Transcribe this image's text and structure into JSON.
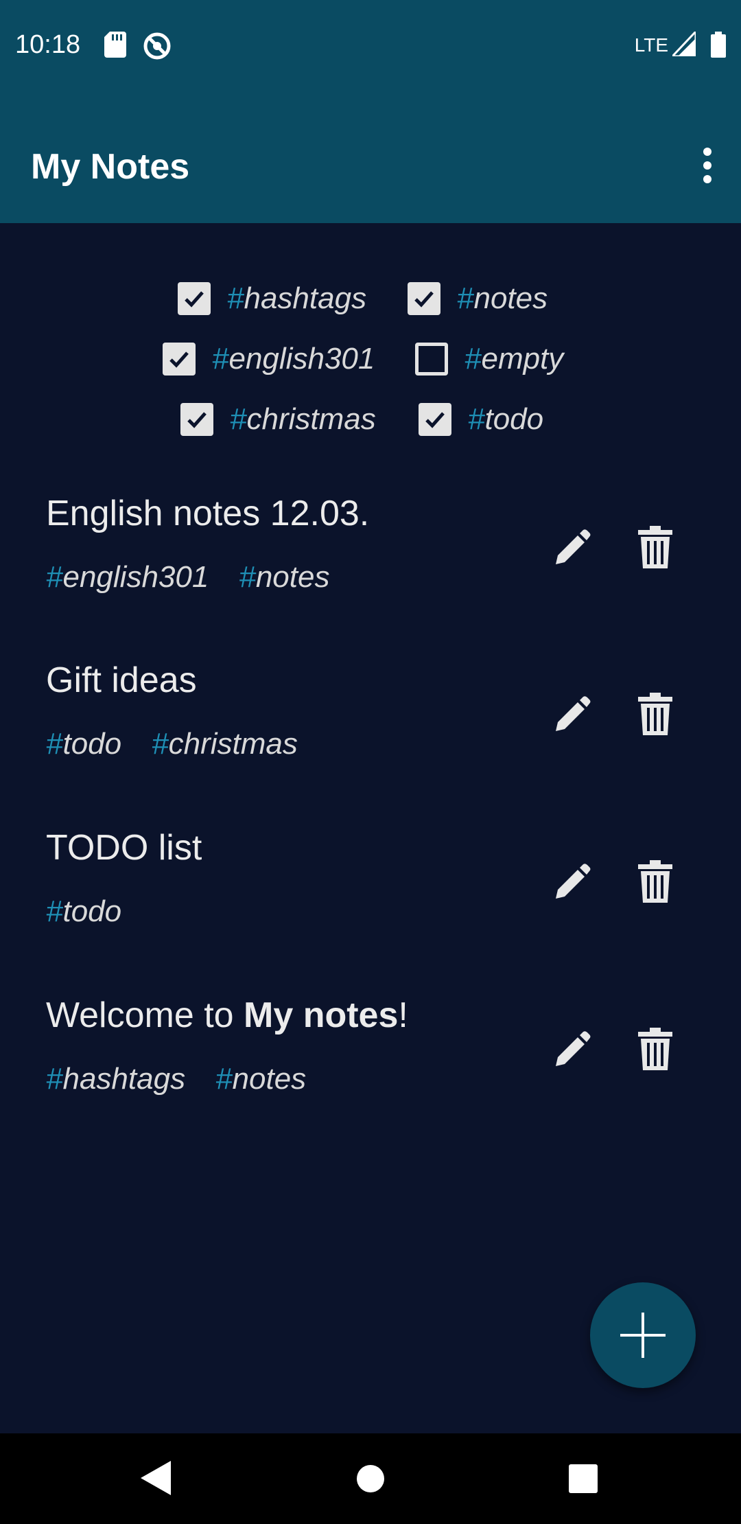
{
  "status_bar": {
    "time": "10:18",
    "network": "LTE",
    "icons": [
      "sd-card-icon",
      "do-not-disturb-icon",
      "signal-icon",
      "battery-icon"
    ]
  },
  "app_bar": {
    "title": "My Notes",
    "menu_icon": "more-vert-icon"
  },
  "filters": [
    {
      "name": "hashtags",
      "checked": true
    },
    {
      "name": "notes",
      "checked": true
    },
    {
      "name": "english301",
      "checked": true
    },
    {
      "name": "empty",
      "checked": false
    },
    {
      "name": "christmas",
      "checked": true
    },
    {
      "name": "todo",
      "checked": true
    }
  ],
  "notes": [
    {
      "title": "English notes 12.03.",
      "tags": [
        "english301",
        "notes"
      ]
    },
    {
      "title": "Gift ideas",
      "tags": [
        "todo",
        "christmas"
      ]
    },
    {
      "title": "TODO list",
      "tags": [
        "todo"
      ]
    },
    {
      "title_prefix": "Welcome to ",
      "title_bold": "My notes",
      "title_suffix": "!",
      "tags": [
        "hashtags",
        "notes"
      ]
    }
  ],
  "hash_symbol": "#",
  "colors": {
    "app_bar": "#0a4b62",
    "background": "#0b132b",
    "hash_accent": "#1e8fb5",
    "text": "#e8e8e8"
  },
  "fab": {
    "icon": "plus-icon"
  },
  "nav_bar": {
    "icons": [
      "back-icon",
      "home-icon",
      "recents-icon"
    ]
  }
}
